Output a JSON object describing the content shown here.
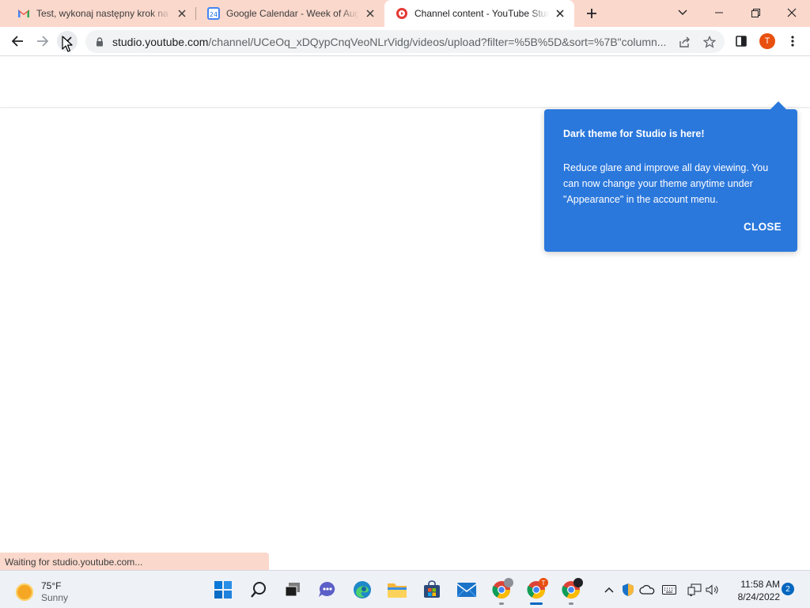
{
  "browser": {
    "tabs": [
      {
        "title": "Test, wykonaj następny krok na u",
        "icon": "gmail-icon"
      },
      {
        "title": "Google Calendar - Week of Augu",
        "icon": "google-calendar-icon",
        "icon_text": "24"
      },
      {
        "title": "Channel content - YouTube Studi",
        "icon": "youtube-studio-icon",
        "active": true
      }
    ],
    "url_host": "studio.youtube.com",
    "url_path": "/channel/UCeOq_xDQypCnqVeoNLrVidg/videos/upload?filter=%5B%5D&sort=%7B\"column...",
    "profile_initial": "T"
  },
  "tooltip": {
    "title": "Dark theme for Studio is here!",
    "body": "Reduce glare and improve all day viewing. You can now change your theme anytime under \"Appearance\" in the account menu.",
    "close_label": "CLOSE"
  },
  "status_text": "Waiting for studio.youtube.com...",
  "taskbar": {
    "weather_temp": "75°F",
    "weather_cond": "Sunny",
    "time": "11:58 AM",
    "date": "8/24/2022",
    "notification_count": "2",
    "chrome_badge": "T"
  },
  "colors": {
    "tab_strip": "#fbd8cc",
    "tooltip_bg": "#2b78dc",
    "profile": "#e8500f",
    "windows_accent": "#0067c0"
  }
}
